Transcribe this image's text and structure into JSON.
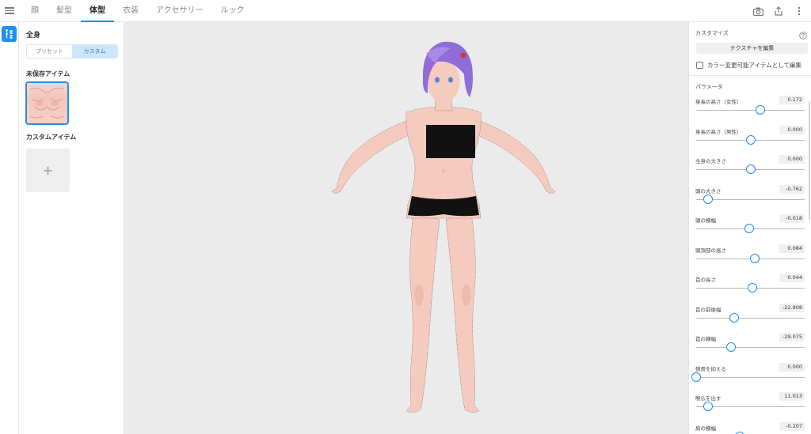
{
  "tabs": [
    {
      "label": "顔",
      "active": false
    },
    {
      "label": "髪型",
      "active": false
    },
    {
      "label": "体型",
      "active": true
    },
    {
      "label": "衣装",
      "active": false
    },
    {
      "label": "アクセサリー",
      "active": false
    },
    {
      "label": "ルック",
      "active": false
    }
  ],
  "toolbar_icons": [
    "camera-icon",
    "share-icon",
    "more-vertical-icon"
  ],
  "left_panel": {
    "title": "全身",
    "segment": {
      "options": [
        "プリセット",
        "カスタム"
      ],
      "selected": "カスタム"
    },
    "unsaved_section": "未保存アイテム",
    "custom_section": "カスタムアイテム",
    "add_symbol": "+"
  },
  "right_panel": {
    "customize_title": "カスタマイズ",
    "edit_texture_button": "テクスチャを編集",
    "color_checkbox_label": "カラー変更可能アイテムとして編集",
    "color_checkbox_checked": false,
    "params_title": "パラメータ",
    "params": [
      {
        "label": "身長の高さ（女性）",
        "value": "0.172",
        "fraction": 0.59
      },
      {
        "label": "身長の高さ（男性）",
        "value": "0.000",
        "fraction": 0.5
      },
      {
        "label": "全身の大きさ",
        "value": "0.000",
        "fraction": 0.5
      },
      {
        "label": "頭の大きさ",
        "value": "-0.762",
        "fraction": 0.11
      },
      {
        "label": "頭の横幅",
        "value": "-0.018",
        "fraction": 0.49
      },
      {
        "label": "頭頂部の高さ",
        "value": "0.084",
        "fraction": 0.54
      },
      {
        "label": "首の長さ",
        "value": "0.044",
        "fraction": 0.52
      },
      {
        "label": "首の前後幅",
        "value": "-22.908",
        "fraction": 0.35
      },
      {
        "label": "首の横幅",
        "value": "-29.075",
        "fraction": 0.32
      },
      {
        "label": "鎖骨を抑える",
        "value": "0.000",
        "fraction": 0.0
      },
      {
        "label": "喉仏を出す",
        "value": "11.013",
        "fraction": 0.11
      },
      {
        "label": "肩の横幅",
        "value": "-0.207",
        "fraction": 0.4
      }
    ]
  },
  "colors": {
    "accent": "#1e8ee9",
    "viewport_bg": "#ebebeb",
    "skin": "#f6cbbf",
    "hair": "#8f6cd8",
    "clothing": "#111111"
  }
}
